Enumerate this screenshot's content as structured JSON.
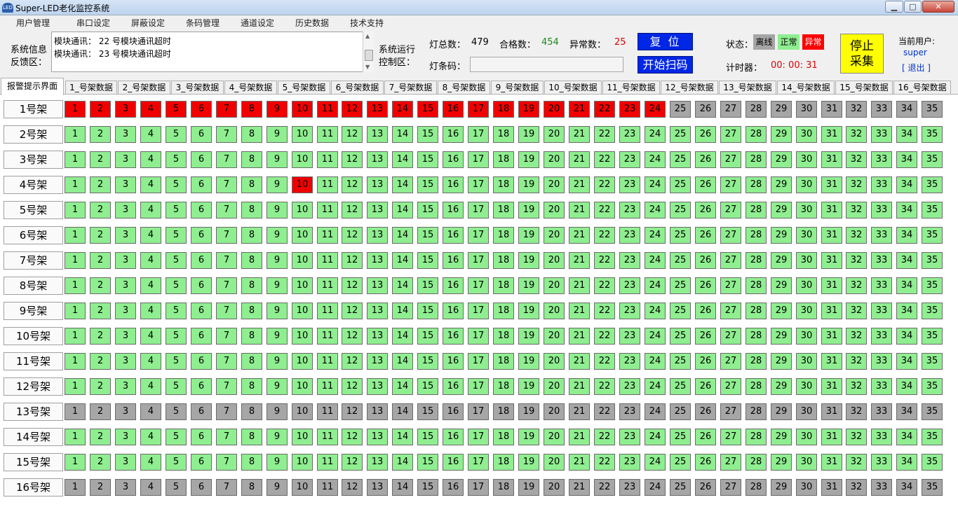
{
  "window": {
    "title": "Super-LED老化监控系统",
    "app_icon": "app-logo-icon",
    "controls": [
      "minimize-icon",
      "maximize-icon",
      "close-icon"
    ]
  },
  "menu": [
    "用户管理",
    "串口设定",
    "屏蔽设定",
    "条码管理",
    "通道设定",
    "历史数据",
    "技术支持"
  ],
  "info": {
    "label_line1": "系统信息",
    "label_line2": "反馈区：",
    "messages": [
      "模块通讯： 22 号模块通讯超时",
      "模块通讯： 23 号模块通讯超时"
    ]
  },
  "control": {
    "label_line1": "系统运行",
    "label_line2": "控制区："
  },
  "stats": {
    "total_label": "灯总数：",
    "total_value": "479",
    "pass_label": "合格数：",
    "pass_value": "454",
    "fail_label": "异常数：",
    "fail_value": "25",
    "barcode_label": "灯条码：",
    "barcode_value": ""
  },
  "buttons": {
    "reset": "复位",
    "scan": "开始扫码",
    "stop_line1": "停止",
    "stop_line2": "采集"
  },
  "status": {
    "label": "状态：",
    "offline": "离线",
    "normal": "正常",
    "abnormal": "异常",
    "timer_label": "计时器：",
    "timer_value": "00: 00: 31"
  },
  "user": {
    "label": "当前用户:",
    "name": "super",
    "logout": "[ 退出 ]"
  },
  "colors": {
    "normal": "#8fee90",
    "abnormal": "#f20000",
    "offline": "#a6a6a6",
    "button_blue": "#0026e6",
    "stop_yellow": "#ffff00"
  },
  "tabs": [
    "报警提示界面",
    "1_号架数据",
    "2_号架数据",
    "3_号架数据",
    "4_号架数据",
    "5_号架数据",
    "6_号架数据",
    "7_号架数据",
    "8_号架数据",
    "9_号架数据",
    "10_号架数据",
    "11_号架数据",
    "12_号架数据",
    "13_号架数据",
    "14_号架数据",
    "15_号架数据",
    "16_号架数据"
  ],
  "active_tab": 0,
  "racks": [
    {
      "label": "1号架",
      "status": "rrrrrrrrrrrrrrrrrrrrrrrrggggggggggg"
    },
    {
      "label": "2号架",
      "status": "nnnnnnnnnnnnnnnnnnnnnnnnnnnnnnnnnnn"
    },
    {
      "label": "3号架",
      "status": "nnnnnnnnnnnnnnnnnnnnnnnnnnnnnnnnnnn"
    },
    {
      "label": "4号架",
      "status": "nnnnnnnnnrnnnnnnnnnnnnnnnnnnnnnnnnn"
    },
    {
      "label": "5号架",
      "status": "nnnnnnnnnnnnnnnnnnnnnnnnnnnnnnnnnnn"
    },
    {
      "label": "6号架",
      "status": "nnnnnnnnnnnnnnnnnnnnnnnnnnnnnnnnnnn"
    },
    {
      "label": "7号架",
      "status": "nnnnnnnnnnnnnnnnnnnnnnnnnnnnnnnnnnn"
    },
    {
      "label": "8号架",
      "status": "nnnnnnnnnnnnnnnnnnnnnnnnnnnnnnnnnnn"
    },
    {
      "label": "9号架",
      "status": "nnnnnnnnnnnnnnnnnnnnnnnnnnnnnnnnnnn"
    },
    {
      "label": "10号架",
      "status": "nnnnnnnnnnnnnnnnnnnnnnnnnnnnnnnnnnn"
    },
    {
      "label": "11号架",
      "status": "nnnnnnnnnnnnnnnnnnnnnnnnnnnnnnnnnnn"
    },
    {
      "label": "12号架",
      "status": "nnnnnnnnnnnnnnnnnnnnnnnnnnnnnnnnnnn"
    },
    {
      "label": "13号架",
      "status": "ggggggggggggggggggggggggggggggggggg"
    },
    {
      "label": "14号架",
      "status": "nnnnnnnnnnnnnnnnnnnnnnnnnnnnnnnnnnn"
    },
    {
      "label": "15号架",
      "status": "nnnnnnnnnnnnnnnnnnnnnnnnnnnnnnnnnnn"
    },
    {
      "label": "16号架",
      "status": "ggggggggggggggggggggggggggggggggggg"
    }
  ],
  "status_legend": {
    "n": "正常",
    "r": "异常",
    "g": "离线"
  }
}
